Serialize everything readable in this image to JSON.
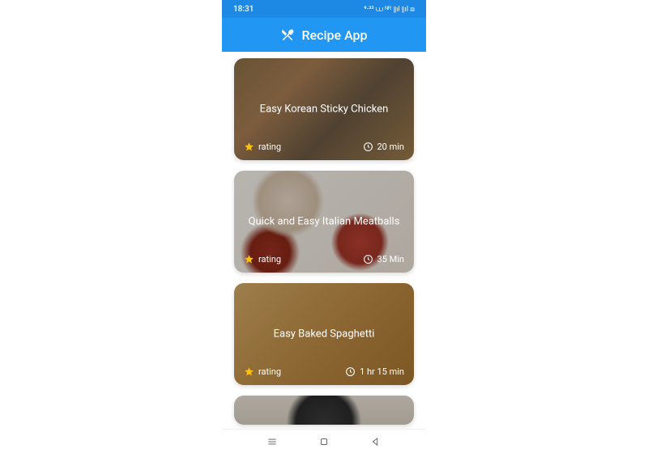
{
  "statusBar": {
    "time": "18:31",
    "indicators": "⁹·³² ⩊ ᴺᴿ ⫴ıl ⫴ıl ⧈"
  },
  "appBar": {
    "title": "Recipe App"
  },
  "recipes": [
    {
      "title": "Easy Korean Sticky Chicken",
      "ratingLabel": "rating",
      "time": "20 min"
    },
    {
      "title": "Quick and Easy Italian Meatballs",
      "ratingLabel": "rating",
      "time": "35 Min"
    },
    {
      "title": "Easy Baked Spaghetti",
      "ratingLabel": "rating",
      "time": "1 hr 15 min"
    },
    {
      "title": "",
      "ratingLabel": "",
      "time": ""
    }
  ]
}
